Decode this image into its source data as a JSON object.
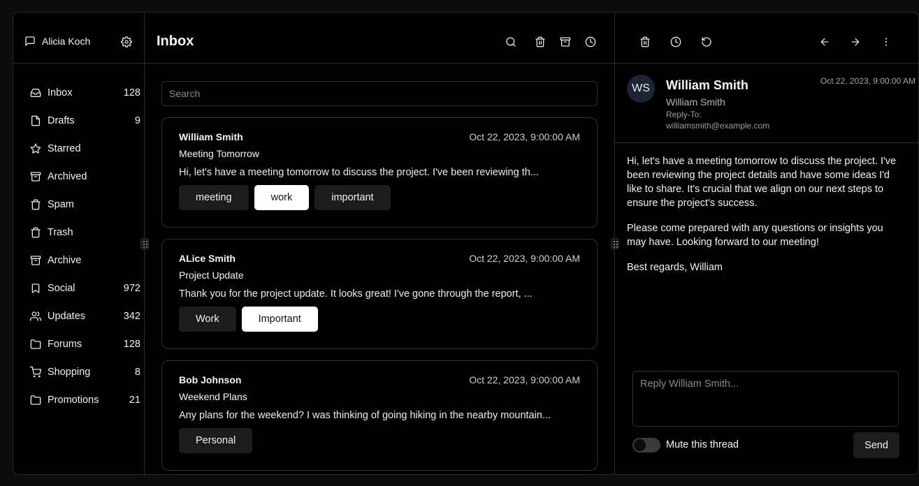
{
  "account": {
    "name": "Alicia Koch",
    "icon": "message-square-icon",
    "settings_icon": "gear-icon"
  },
  "sidebar": {
    "items": [
      {
        "label": "Inbox",
        "count": "128",
        "icon": "inbox-icon"
      },
      {
        "label": "Drafts",
        "count": "9",
        "icon": "file-icon"
      },
      {
        "label": "Starred",
        "count": "",
        "icon": "star-icon"
      },
      {
        "label": "Archived",
        "count": "",
        "icon": "archive-icon"
      },
      {
        "label": "Spam",
        "count": "",
        "icon": "trash-icon"
      },
      {
        "label": "Trash",
        "count": "",
        "icon": "trash-icon"
      },
      {
        "label": "Archive",
        "count": "",
        "icon": "archive-icon"
      },
      {
        "label": "Social",
        "count": "972",
        "icon": "bookmark-icon"
      },
      {
        "label": "Updates",
        "count": "342",
        "icon": "users-icon"
      },
      {
        "label": "Forums",
        "count": "128",
        "icon": "folder-icon"
      },
      {
        "label": "Shopping",
        "count": "8",
        "icon": "cart-icon"
      },
      {
        "label": "Promotions",
        "count": "21",
        "icon": "folder-icon"
      }
    ]
  },
  "list": {
    "title": "Inbox",
    "search_placeholder": "Search",
    "toolbar_icons": [
      "search-icon",
      "trash-icon",
      "archive-icon",
      "clock-icon"
    ],
    "emails": [
      {
        "from": "William Smith",
        "date": "Oct 22, 2023, 9:00:00 AM",
        "subject": "Meeting Tomorrow",
        "preview": "Hi, let's have a meeting tomorrow to discuss the project. I've been reviewing th...",
        "tags": [
          {
            "label": "meeting",
            "highlight": false
          },
          {
            "label": "work",
            "highlight": true
          },
          {
            "label": "important",
            "highlight": false
          }
        ]
      },
      {
        "from": "ALice Smith",
        "date": "Oct 22, 2023, 9:00:00 AM",
        "subject": "Project Update",
        "preview": "Thank you for the project update. It looks great! I've gone through the report, ...",
        "tags": [
          {
            "label": "Work",
            "highlight": false
          },
          {
            "label": "Important",
            "highlight": true
          }
        ]
      },
      {
        "from": "Bob Johnson",
        "date": "Oct 22, 2023, 9:00:00 AM",
        "subject": "Weekend Plans",
        "preview": "Any plans for the weekend? I was thinking of going hiking in the nearby mountain...",
        "tags": [
          {
            "label": "Personal",
            "highlight": false
          }
        ]
      }
    ]
  },
  "detail": {
    "toolbar_icons": [
      "trash-icon",
      "clock-icon",
      "rotate-ccw-icon",
      "arrow-left-icon",
      "arrow-right-icon",
      "more-vertical-icon"
    ],
    "avatar_initials": "WS",
    "name": "William Smith",
    "subject": "William Smith",
    "reply_to_label": "Reply-To:",
    "reply_to_email": "williamsmith@example.com",
    "date": "Oct 22, 2023, 9:00:00 AM",
    "body": [
      "Hi, let's have a meeting tomorrow to discuss the project. I've been reviewing the project details and have some ideas I'd like to share. It's crucial that we align on our next steps to ensure the project's success.",
      "Please come prepared with any questions or insights you may have. Looking forward to our meeting!",
      "Best regards, William"
    ],
    "reply_placeholder": "Reply William Smith...",
    "mute_label": "Mute this thread",
    "mute_on": false,
    "send_label": "Send"
  }
}
